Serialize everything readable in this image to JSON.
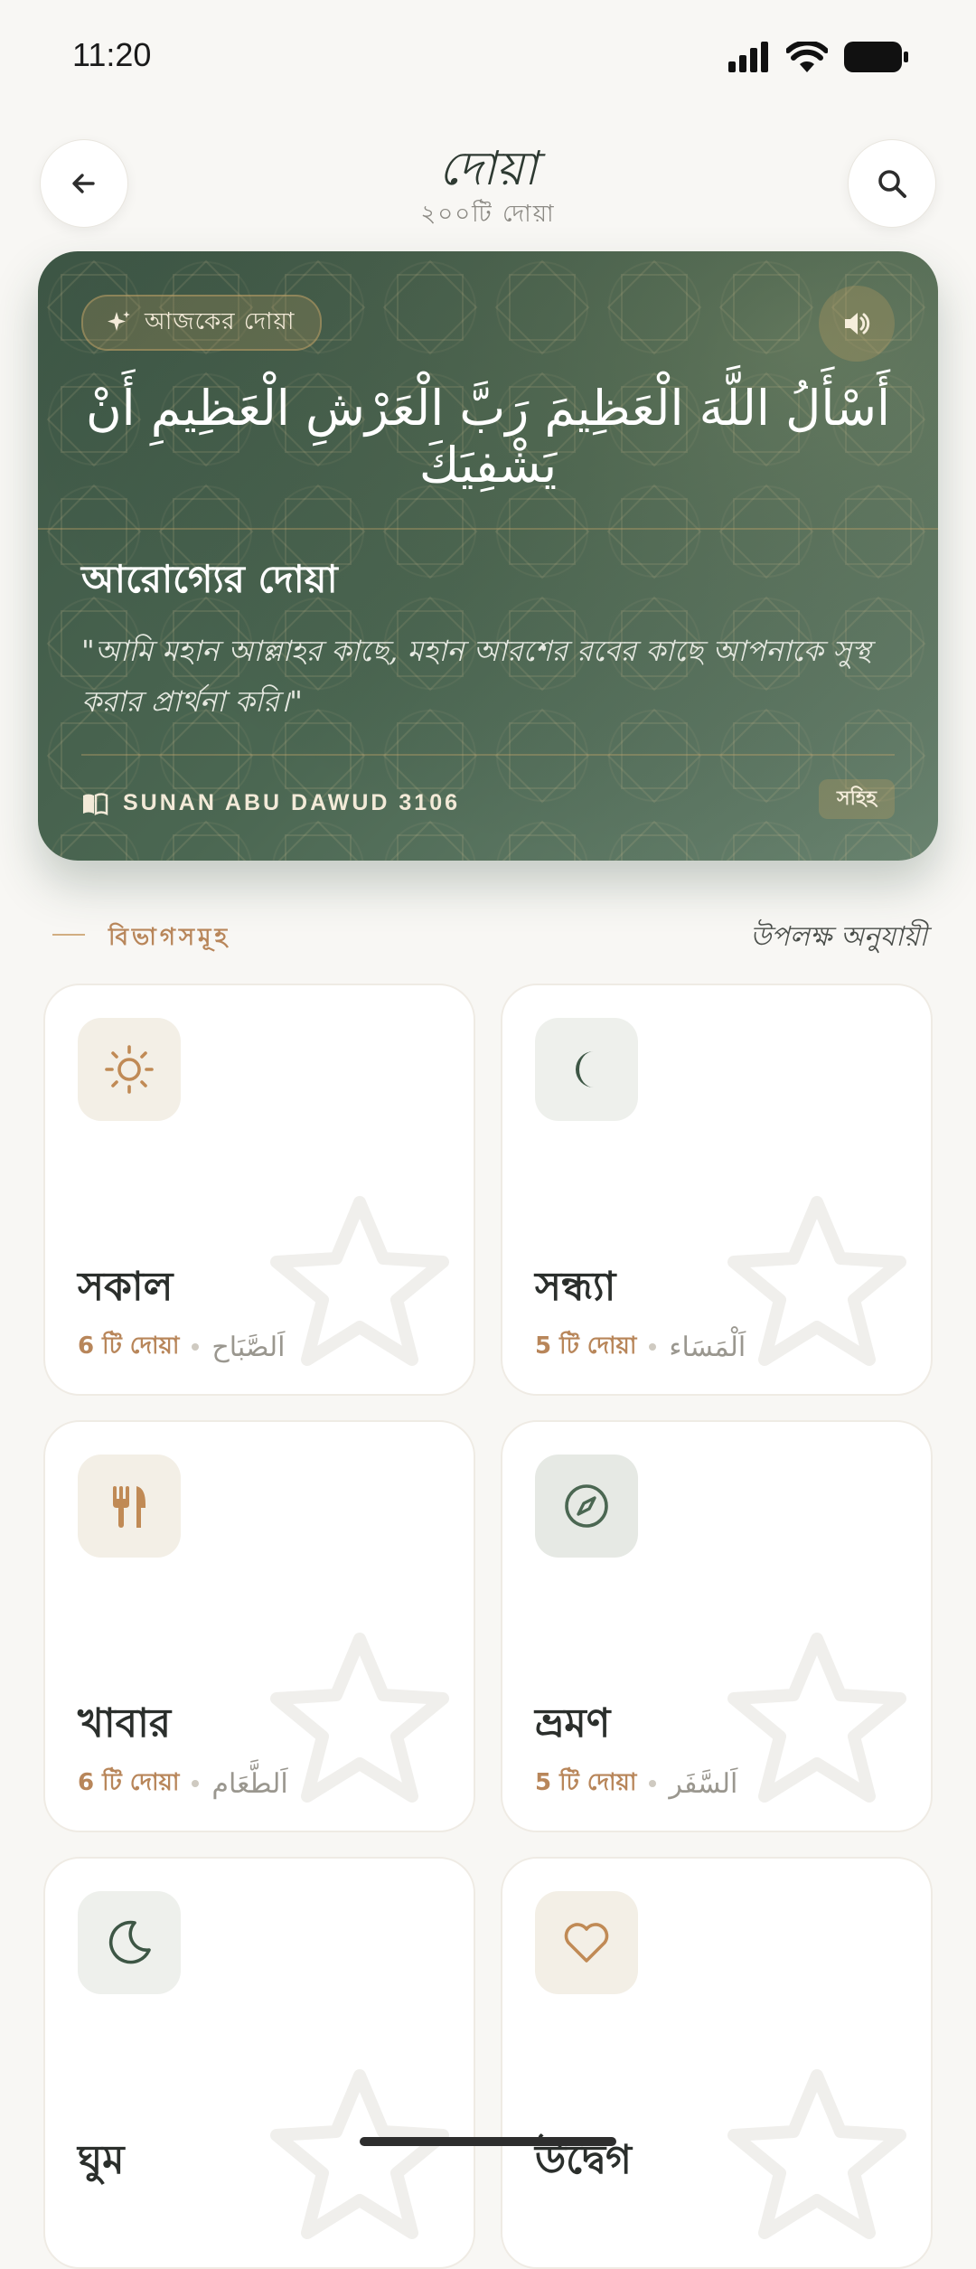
{
  "status_bar": {
    "time": "11:20"
  },
  "header": {
    "title": "দোয়া",
    "subtitle": "২০০টি দোয়া",
    "back_icon": "arrow-left-icon",
    "search_icon": "search-icon"
  },
  "hero": {
    "badge": "আজকের দোয়া",
    "arabic": "أَسْأَلُ اللَّهَ الْعَظِيمَ رَبَّ الْعَرْشِ الْعَظِيمِ أَنْ يَشْفِيَكَ",
    "title": "আরোগ্যের দোয়া",
    "translation": "\"আমি মহান আল্লাহর কাছে, মহান আরশের রবের কাছে আপনাকে সুস্থ করার প্রার্থনা করি।\"",
    "reference": "SUNAN ABU DAWUD 3106",
    "grade": "সহিহ"
  },
  "section": {
    "label": "বিভাগসমূহ",
    "link": "উপলক্ষ অনুযায়ী"
  },
  "categories": [
    {
      "title": "সকাল",
      "count": "6 টি দোয়া",
      "arabic": "اَلصَّبَاح",
      "icon": "sun-icon"
    },
    {
      "title": "সন্ধ্যা",
      "count": "5 টি দোয়া",
      "arabic": "اَلْمَسَاء",
      "icon": "moon-icon"
    },
    {
      "title": "খাবার",
      "count": "6 টি দোয়া",
      "arabic": "اَلطَّعَام",
      "icon": "fork-knife-icon"
    },
    {
      "title": "ভ্রমণ",
      "count": "5 টি দোয়া",
      "arabic": "اَلسَّفَر",
      "icon": "compass-icon"
    },
    {
      "title": "ঘুম",
      "icon": "crescent-icon"
    },
    {
      "title": "উদ্বেগ",
      "icon": "heart-icon"
    }
  ],
  "colors": {
    "background": "#f8f7f4",
    "hero_green": "#4b6752",
    "accent_gold": "#b8865a",
    "text_dark": "#2b2f2c"
  }
}
